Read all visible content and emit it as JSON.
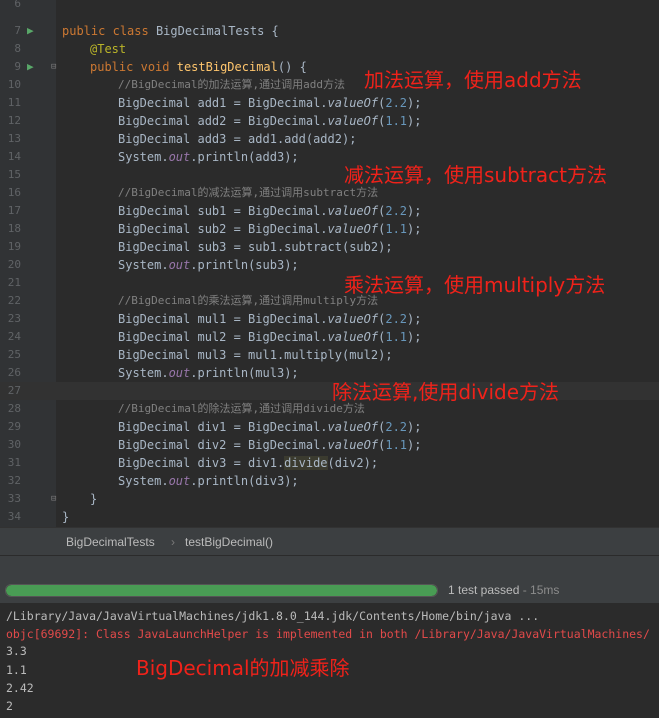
{
  "editor": {
    "lines": [
      {
        "n": "6"
      },
      {
        "n": "7"
      },
      {
        "n": "8"
      },
      {
        "n": "9"
      },
      {
        "n": "10"
      },
      {
        "n": "11"
      },
      {
        "n": "12"
      },
      {
        "n": "13"
      },
      {
        "n": "14"
      },
      {
        "n": "15"
      },
      {
        "n": "16"
      },
      {
        "n": "17"
      },
      {
        "n": "18"
      },
      {
        "n": "19"
      },
      {
        "n": "20"
      },
      {
        "n": "21"
      },
      {
        "n": "22"
      },
      {
        "n": "23"
      },
      {
        "n": "24"
      },
      {
        "n": "25"
      },
      {
        "n": "26"
      },
      {
        "n": "27"
      },
      {
        "n": "28"
      },
      {
        "n": "29"
      },
      {
        "n": "30"
      },
      {
        "n": "31"
      },
      {
        "n": "32"
      },
      {
        "n": "33"
      },
      {
        "n": "34"
      }
    ],
    "tokens": {
      "public": "public",
      "class": "class",
      "void": "void",
      "class_name": "BigDecimalTests",
      "brace_open": " {",
      "brace_close": "}",
      "annotation": "@Test",
      "method_name": "testBigDecimal",
      "method_sig_rest": "() {",
      "type": "BigDecimal",
      "dot_valueof": ".",
      "valueof": "valueOf",
      "num_a": "2.2",
      "num_b": "1.1",
      "open_paren": "(",
      "close_paren_semi": ");",
      "system": "System.",
      "out": "out",
      "println_open": ".println(",
      "c1": "//BigDecimal的加法运算,通过调用add方法",
      "c2": "//BigDecimal的减法运算,通过调用subtract方法",
      "c3": "//BigDecimal的乘法运算,通过调用multiply方法",
      "c4": "//BigDecimal的除法运算,通过调用divide方法",
      "add1_decl": " add1 = BigDecimal",
      "add2_decl": " add2 = BigDecimal",
      "add3_decl": " add3 = add1.add(add2);",
      "add3": "add3",
      "sub1_decl": " sub1 = BigDecimal",
      "sub2_decl": " sub2 = BigDecimal",
      "sub3_decl": " sub3 = sub1.subtract(sub2);",
      "sub3": "sub3",
      "mul1_decl": " mul1 = BigDecimal",
      "mul2_decl": " mul2 = BigDecimal",
      "mul3_decl": " mul3 = mul1.multiply(mul2);",
      "mul3": "mul3",
      "div1_decl": " div1 = BigDecimal",
      "div2_decl": " div2 = BigDecimal",
      "div3_pre": " div3 = div1.",
      "divide": "divide",
      "div3_post": "(div2);",
      "div3": "div3"
    }
  },
  "annotations": {
    "add": "加法运算，使用add方法",
    "subtract": "减法运算，使用subtract方法",
    "multiply": "乘法运算，使用multiply方法",
    "divide": "除法运算,使用divide方法",
    "summary": "BigDecimal的加减乘除"
  },
  "breadcrumb": {
    "class": "BigDecimalTests",
    "separator": "›",
    "method": "testBigDecimal()"
  },
  "run": {
    "status": "1 test passed",
    "duration": " - 15ms",
    "progress_fraction": 1.0,
    "progress_color": "#499c54"
  },
  "console": {
    "cmd": "/Library/Java/JavaVirtualMachines/jdk1.8.0_144.jdk/Contents/Home/bin/java ...",
    "error": "objc[69692]: Class JavaLaunchHelper is implemented in both /Library/Java/JavaVirtualMachines/",
    "outputs": [
      "3.3",
      "1.1",
      "2.42",
      "2"
    ]
  },
  "colors": {
    "annotation_red": "#f0221a",
    "keyword": "#cc7832",
    "number": "#6897bb",
    "static_field": "#9876aa",
    "method": "#ffc66d",
    "annotation": "#bbb529",
    "comment": "#808080"
  },
  "icons": [
    "run-test-icon",
    "fold-icon"
  ]
}
